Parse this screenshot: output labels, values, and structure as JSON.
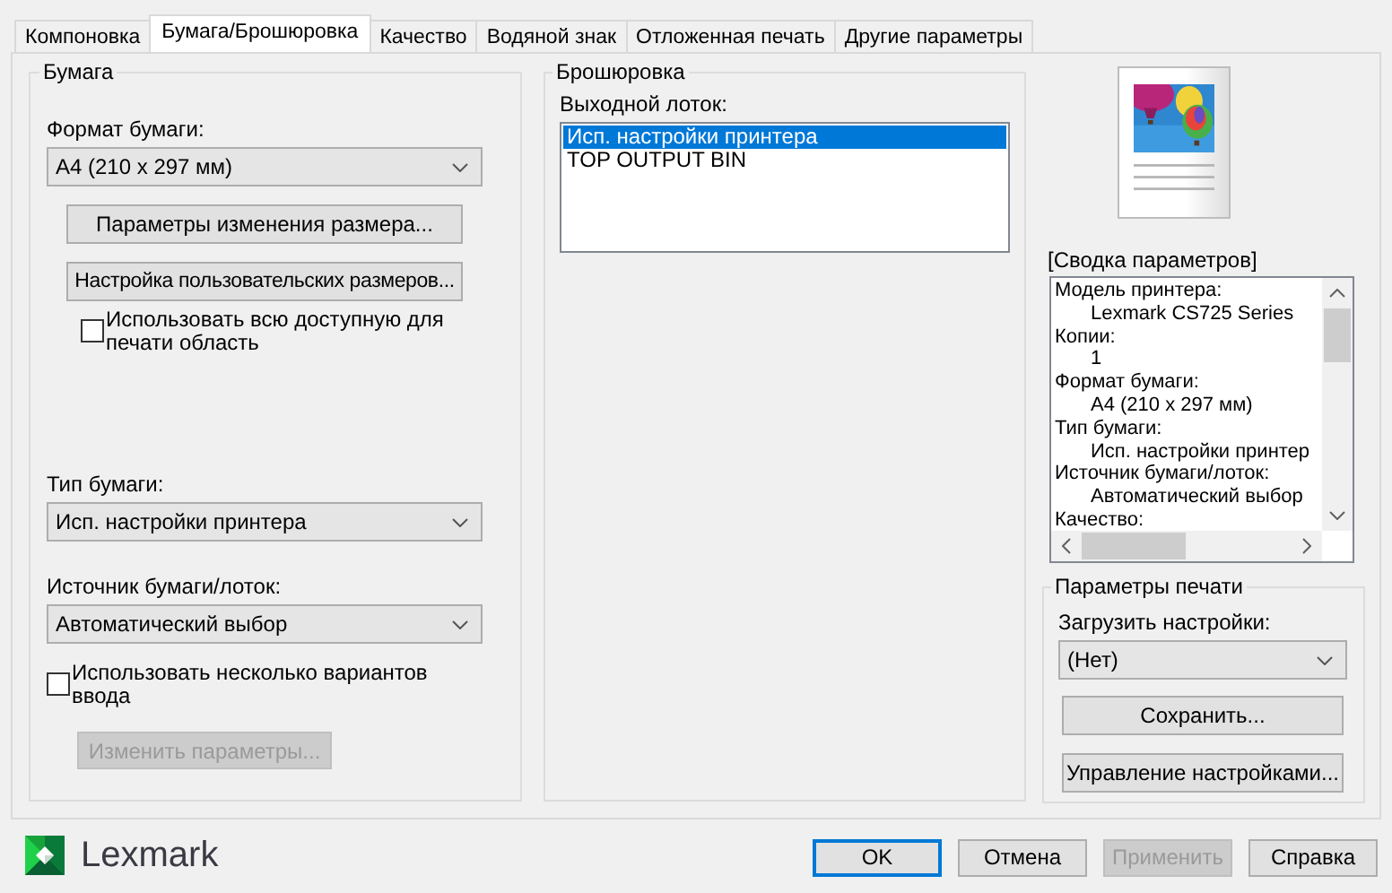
{
  "tabs": [
    {
      "label": "Компоновка",
      "selected": false
    },
    {
      "label": "Бумага/Брошюровка",
      "selected": true
    },
    {
      "label": "Качество",
      "selected": false
    },
    {
      "label": "Водяной знак",
      "selected": false
    },
    {
      "label": "Отложенная печать",
      "selected": false
    },
    {
      "label": "Другие параметры",
      "selected": false
    }
  ],
  "paper": {
    "title": "Бумага",
    "size_label": "Формат бумаги:",
    "size_value": "A4 (210 x 297 мм)",
    "buttons": [
      {
        "label": "Параметры изменения размера...",
        "disabled": false
      },
      {
        "label": "Настройка пользовательских размеров...",
        "disabled": false
      }
    ],
    "printable_area": {
      "label": "Использовать всю доступную для печати область",
      "checked": false
    },
    "type_label": "Тип бумаги:",
    "type_value": "Исп. настройки принтера",
    "source_label": "Источник бумаги/лоток:",
    "source_value": "Автоматический выбор",
    "multi_input": {
      "label": "Использовать несколько вариантов ввода",
      "checked": false
    },
    "change_button": {
      "label": "Изменить параметры...",
      "disabled": true
    }
  },
  "finishing": {
    "title": "Брошюровка",
    "tray_label": "Выходной лоток:",
    "trays": [
      {
        "label": "Исп. настройки принтера",
        "selected": true
      },
      {
        "label": "TOP OUTPUT BIN",
        "selected": false
      }
    ]
  },
  "summary": {
    "title": "[Сводка параметров]",
    "items": [
      {
        "heading": "Модель принтера:",
        "value": "Lexmark CS725 Series"
      },
      {
        "heading": "Копии:",
        "value": "1"
      },
      {
        "heading": "Формат бумаги:",
        "value": "A4 (210 x 297 мм)"
      },
      {
        "heading": "Тип бумаги:",
        "value": "Исп. настройки принтер"
      },
      {
        "heading": "Источник бумаги/лоток:",
        "value": "Автоматический выбор"
      },
      {
        "heading": "Качество:"
      }
    ]
  },
  "print_settings": {
    "title": "Параметры печати",
    "load_label": "Загрузить настройки:",
    "load_value": "(Нет)",
    "buttons": [
      {
        "label": "Сохранить..."
      },
      {
        "label": "Управление настройками..."
      }
    ]
  },
  "brand": "Lexmark",
  "buttons": [
    {
      "label": "OK",
      "default": true,
      "disabled": false
    },
    {
      "label": "Отмена",
      "default": false,
      "disabled": false
    },
    {
      "label": "Применить",
      "default": false,
      "disabled": true
    },
    {
      "label": "Справка",
      "default": false,
      "disabled": false
    }
  ]
}
